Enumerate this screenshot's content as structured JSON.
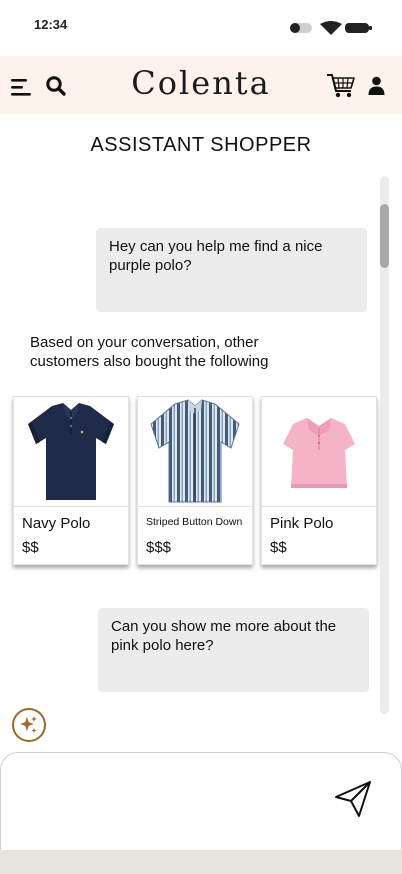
{
  "status_bar": {
    "time": "12:34"
  },
  "header": {
    "brand": "Colenta",
    "icons": [
      "menu-icon",
      "search-icon",
      "cart-icon",
      "user-icon"
    ],
    "background": "#fdf3ec"
  },
  "page": {
    "title": "ASSISTANT SHOPPER"
  },
  "chat": {
    "messages": [
      {
        "role": "user",
        "text": "Hey can you help me find a nice purple polo?"
      },
      {
        "role": "assistant",
        "text": "Based on your conversation, other customers also bought the following"
      },
      {
        "role": "user",
        "text": "Can you show me more about the pink polo here?"
      }
    ],
    "products": [
      {
        "name": "Navy Polo",
        "price": "$$",
        "color": "#1e2a47"
      },
      {
        "name": "Striped Button Down",
        "price": "$$$",
        "color": "#6d8aa8"
      },
      {
        "name": "Pink Polo",
        "price": "$$",
        "color": "#f2aac0"
      }
    ]
  },
  "composer": {
    "placeholder": "",
    "value": "",
    "icons": [
      "sparkle-icon",
      "send-icon"
    ]
  },
  "colors": {
    "accent": "#9a6a2c",
    "bubble": "#ececec",
    "bottom_bar": "#e7e3df"
  }
}
